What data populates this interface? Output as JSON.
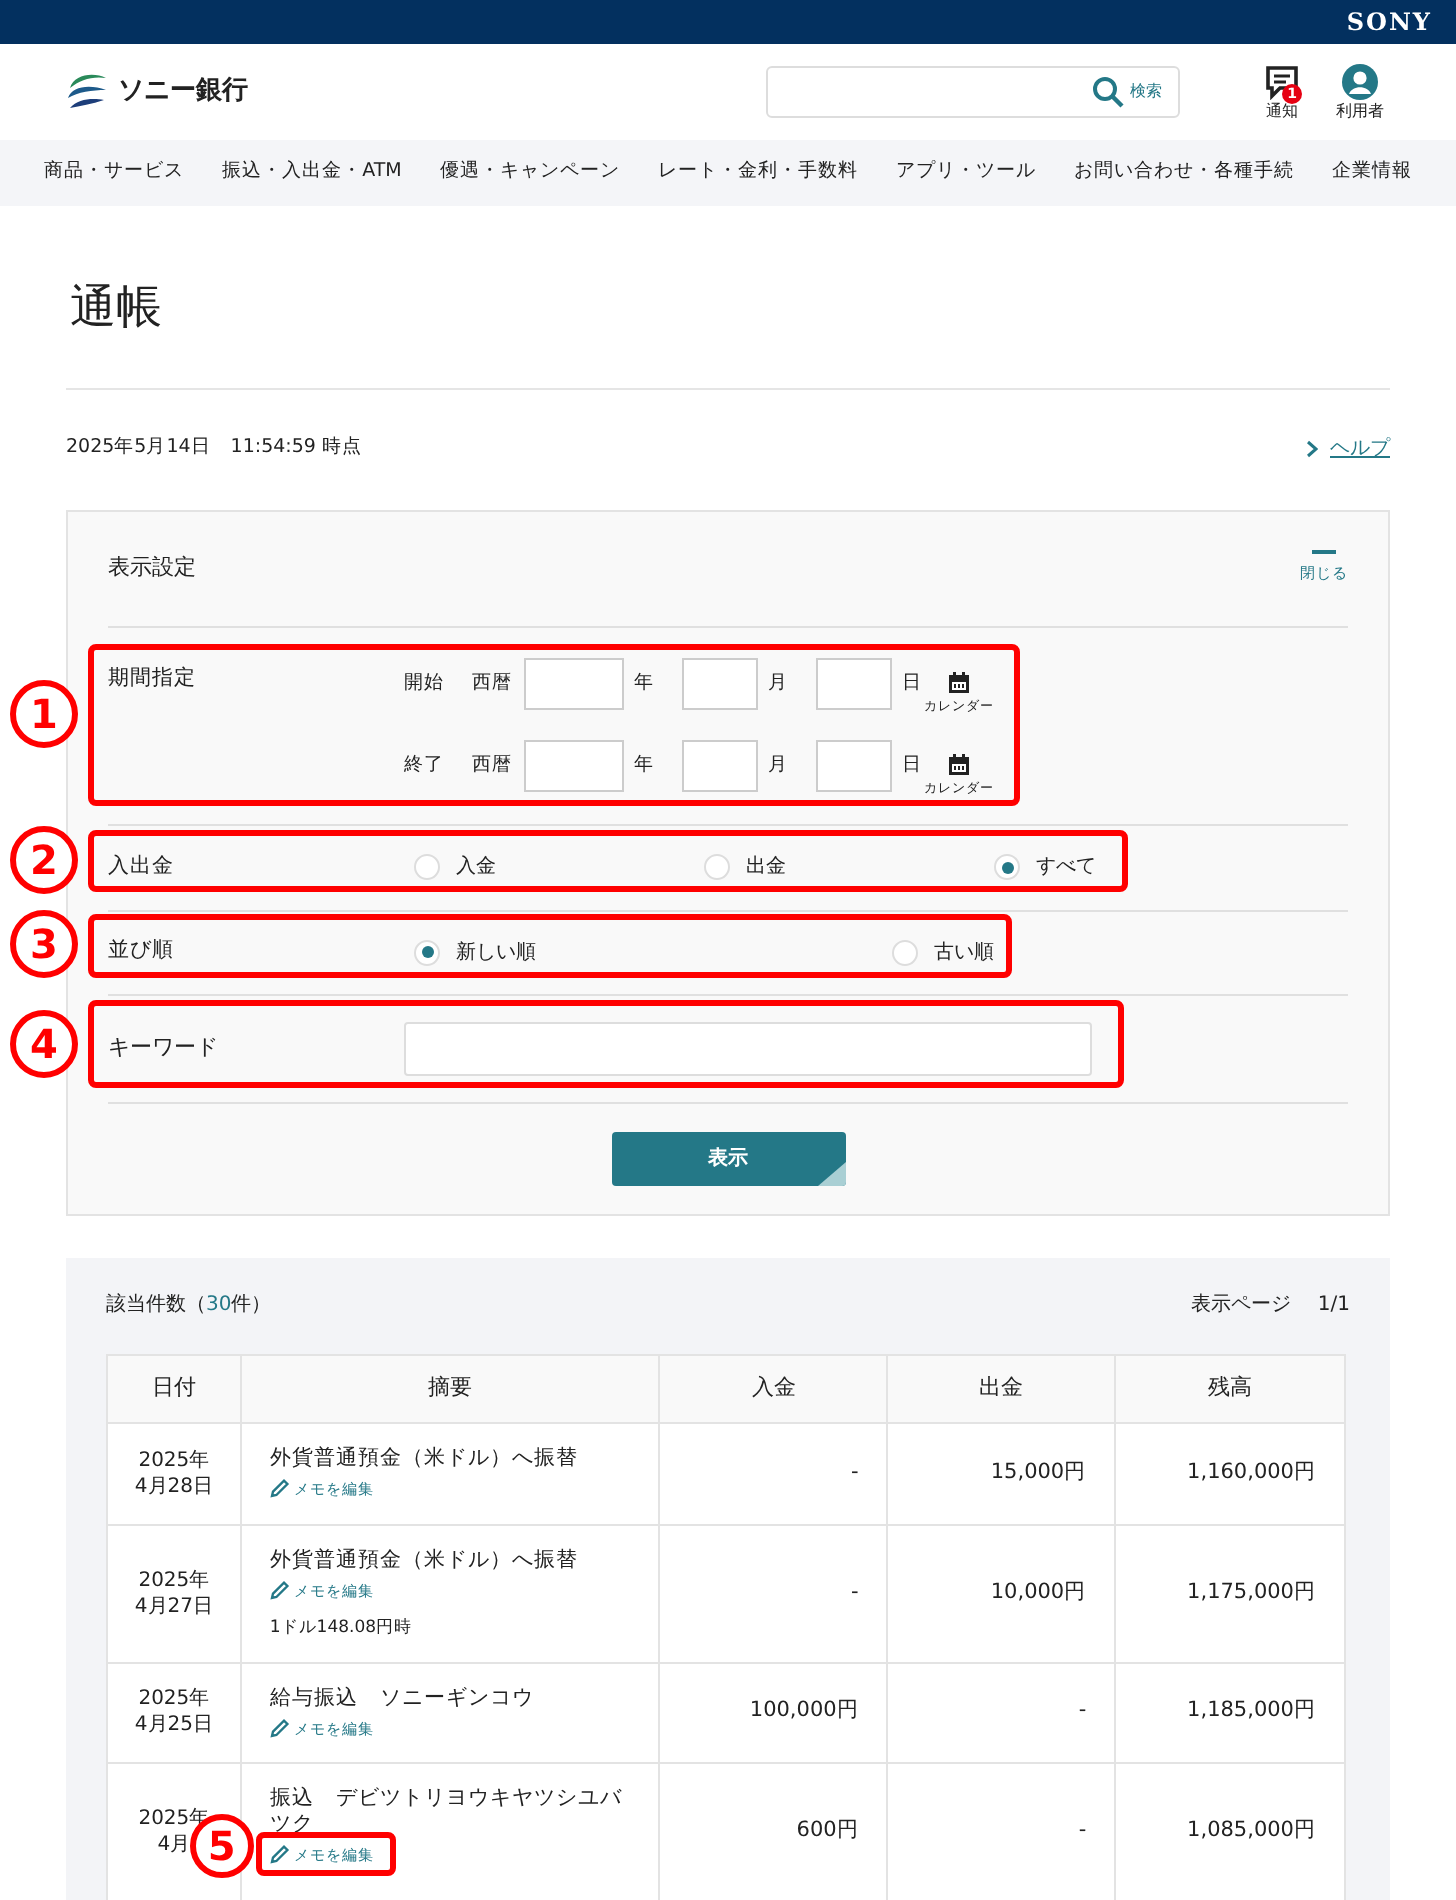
{
  "brand_bar": {
    "logo": "SONY"
  },
  "header": {
    "logo": "ソニー銀行",
    "search": {
      "button": "検索"
    },
    "actions": [
      {
        "kind": "notification",
        "label": "通知",
        "badge": "1"
      },
      {
        "kind": "user",
        "label": "利用者"
      }
    ]
  },
  "nav": [
    "商品・サービス",
    "振込・入出金・ATM",
    "優遇・キャンペーン",
    "レート・金利・手数料",
    "アプリ・ツール",
    "お問い合わせ・各種手続",
    "企業情報"
  ],
  "page_title": "通帳",
  "timestamp": "2025年5月14日　11:54:59 時点",
  "help_link": "ヘルプ",
  "settings": {
    "title": "表示設定",
    "collapse": "閉じる",
    "period": {
      "label": "期間指定",
      "rows": [
        {
          "label": "開始",
          "era": "西暦",
          "year": "年",
          "month": "月",
          "day": "日",
          "calendar": "カレンダー"
        },
        {
          "label": "終了",
          "era": "西暦",
          "year": "年",
          "month": "月",
          "day": "日",
          "calendar": "カレンダー"
        }
      ]
    },
    "direction": {
      "label": "入出金",
      "options": [
        {
          "label": "入金",
          "selected": false
        },
        {
          "label": "出金",
          "selected": false
        },
        {
          "label": "すべて",
          "selected": true
        }
      ]
    },
    "order": {
      "label": "並び順",
      "options": [
        {
          "label": "新しい順",
          "selected": true
        },
        {
          "label": "古い順",
          "selected": false
        }
      ]
    },
    "keyword": {
      "label": "キーワード"
    },
    "submit": "表示"
  },
  "results": {
    "count_prefix": "該当件数（",
    "count": "30",
    "count_suffix": "件）",
    "page_label": "表示ページ",
    "page": "1/1",
    "table": {
      "columns": [
        "日付",
        "摘要",
        "入金",
        "出金",
        "残高"
      ],
      "rows": [
        {
          "date_year": "2025年",
          "date_day": "4月28日",
          "description": "外貨普通預金（米ドル）へ振替",
          "memo": "メモを編集",
          "deposit": "-",
          "withdrawal": "15,000円",
          "balance": "1,160,000円"
        },
        {
          "date_year": "2025年",
          "date_day": "4月27日",
          "description": "外貨普通預金（米ドル）へ振替",
          "memo": "メモを編集",
          "note": "1ドル148.08円時",
          "deposit": "-",
          "withdrawal": "10,000円",
          "balance": "1,175,000円"
        },
        {
          "date_year": "2025年",
          "date_day": "4月25日",
          "description": "給与振込　ソニーギンコウ",
          "memo": "メモを編集",
          "deposit": "100,000円",
          "withdrawal": "-",
          "balance": "1,185,000円"
        },
        {
          "date_year": "2025年",
          "date_day": "4月",
          "description": "振込　デビツトリヨウキヤツシユバツク",
          "memo": "メモを編集",
          "deposit": "600円",
          "withdrawal": "-",
          "balance": "1,085,000円"
        }
      ]
    }
  },
  "annotations": [
    {
      "label": "1"
    },
    {
      "label": "2"
    },
    {
      "label": "3"
    },
    {
      "label": "4"
    },
    {
      "label": "5"
    }
  ]
}
